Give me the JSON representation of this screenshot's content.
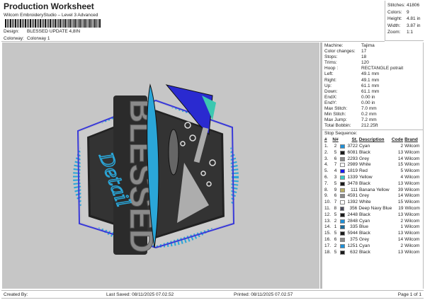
{
  "header": {
    "title": "Production Worksheet",
    "app": "Wilcom EmbroideryStudio – Level 3 Advanced",
    "design_label": "Design:",
    "design": "BLESSED UPDATE 4,8IN",
    "colorway_label": "Colorway:",
    "colorway": "Colorway 1"
  },
  "summary": [
    {
      "k": "Stitches:",
      "v": "41806"
    },
    {
      "k": "Colors:",
      "v": "9"
    },
    {
      "k": "Height:",
      "v": "4.81 in"
    },
    {
      "k": "Width:",
      "v": "3.87 in"
    },
    {
      "k": "Zoom:",
      "v": "1:1"
    }
  ],
  "specs": [
    {
      "k": "Machine:",
      "v": "Tajima"
    },
    {
      "k": "Color changes:",
      "v": "17"
    },
    {
      "k": "Stops:",
      "v": "18"
    },
    {
      "k": "Trims:",
      "v": "120"
    },
    {
      "k": "Hoop :",
      "v": "RECTANGLE potrait"
    },
    {
      "k": "Left:",
      "v": "49.1 mm"
    },
    {
      "k": "Right:",
      "v": "49.1 mm"
    },
    {
      "k": "Up:",
      "v": "61.1 mm"
    },
    {
      "k": "Down:",
      "v": "61.1 mm"
    },
    {
      "k": "EndX:",
      "v": "0.00 in"
    },
    {
      "k": "EndY:",
      "v": "0.00 in"
    },
    {
      "k": "Max Stitch:",
      "v": "7.0 mm"
    },
    {
      "k": "Min Stitch:",
      "v": "0.2 mm"
    },
    {
      "k": "Max Jump:",
      "v": "7.2 mm"
    },
    {
      "k": "Total Bobbin:",
      "v": "212.25ft"
    }
  ],
  "stop_sequence": {
    "title": "Stop Sequence:",
    "headers": [
      "#",
      "N#",
      "St.",
      "Description",
      "Code",
      "Brand"
    ],
    "rows": [
      [
        "1.",
        "2",
        "3722",
        "Cyan",
        "2",
        "Wilcom",
        "#1e90d8"
      ],
      [
        "2.",
        "5",
        "6081",
        "Black",
        "13",
        "Wilcom",
        "#1a1a1a"
      ],
      [
        "3.",
        "6",
        "2293",
        "Grey",
        "14",
        "Wilcom",
        "#8a8a8a"
      ],
      [
        "4.",
        "7",
        "2989",
        "White",
        "15",
        "Wilcom",
        "#ffffff"
      ],
      [
        "5.",
        "4",
        "1819",
        "Red",
        "5",
        "Wilcom",
        "#1a1aee"
      ],
      [
        "6.",
        "3",
        "1339",
        "Yellow",
        "4",
        "Wilcom",
        "#38c8c8"
      ],
      [
        "7.",
        "5",
        "3478",
        "Black",
        "13",
        "Wilcom",
        "#1a1a1a"
      ],
      [
        "8.",
        "9",
        "111",
        "Banana Yellow",
        "39",
        "Wilcom",
        "#b8ae62"
      ],
      [
        "9.",
        "6",
        "4591",
        "Grey",
        "14",
        "Wilcom",
        "#8a8a8a"
      ],
      [
        "10.",
        "7",
        "1392",
        "White",
        "15",
        "Wilcom",
        "#ffffff"
      ],
      [
        "11.",
        "8",
        "356",
        "Deep Navy Blue",
        "19",
        "Wilcom",
        "#4a4a5c"
      ],
      [
        "12.",
        "5",
        "2448",
        "Black",
        "13",
        "Wilcom",
        "#1a1a1a"
      ],
      [
        "13.",
        "2",
        "2848",
        "Cyan",
        "2",
        "Wilcom",
        "#1e90d8"
      ],
      [
        "14.",
        "1",
        "335",
        "Blue",
        "1",
        "Wilcom",
        "#1a6a9a"
      ],
      [
        "15.",
        "5",
        "5944",
        "Black",
        "13",
        "Wilcom",
        "#1a1a1a"
      ],
      [
        "16.",
        "6",
        "375",
        "Grey",
        "14",
        "Wilcom",
        "#8a8a8a"
      ],
      [
        "17.",
        "2",
        "1251",
        "Cyan",
        "2",
        "Wilcom",
        "#1e90d8"
      ],
      [
        "18.",
        "5",
        "632",
        "Black",
        "13",
        "Wilcom",
        "#1a1a1a"
      ]
    ]
  },
  "design_art": {
    "word": "BLESSED",
    "script": "Detail"
  },
  "footer": {
    "created": "Created By:",
    "saved": "Last Saved: 08/11/2025 07.02.52",
    "printed": "Printed: 08/11/2025 07.02.57",
    "page": "Page 1 of 1"
  }
}
